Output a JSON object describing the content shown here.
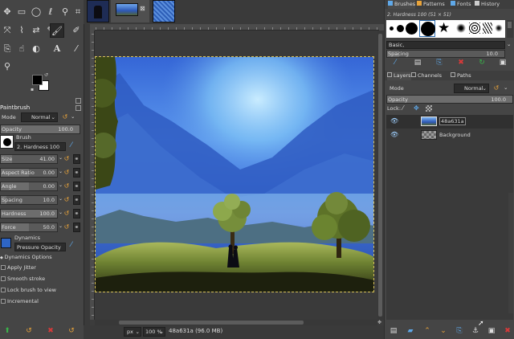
{
  "colors": {
    "accent_orange": "#e8a33a",
    "delete_red": "#d83a3a",
    "confirm_green": "#39b54a",
    "selection_blue": "#2b6cb0",
    "canvas_bg": "#3a3a3a"
  },
  "image_tabs": {
    "active_index": 1,
    "close_glyph": "⊠"
  },
  "tool_options": {
    "tool_name": "Paintbrush",
    "mode_label": "Mode",
    "mode_value": "Normal",
    "opacity_label": "Opacity",
    "opacity_value": "100.0",
    "brush_label": "Brush",
    "brush_value": "2. Hardness 100",
    "sliders": [
      {
        "label": "Size",
        "value": "41.00",
        "level": 0.2
      },
      {
        "label": "Aspect Ratio",
        "value": "0.00",
        "level": 0.5
      },
      {
        "label": "Angle",
        "value": "0.00",
        "level": 0.5
      },
      {
        "label": "Spacing",
        "value": "10.0",
        "level": 0.1
      },
      {
        "label": "Hardness",
        "value": "100.0",
        "level": 1.0
      },
      {
        "label": "Force",
        "value": "50.0",
        "level": 0.5
      }
    ],
    "dynamics_label": "Dynamics",
    "dynamics_value": "Pressure Opacity",
    "dynamics_options": "Dynamics Options",
    "checkboxes": [
      "Apply Jitter",
      "Smooth stroke",
      "Lock brush to view",
      "Incremental"
    ]
  },
  "brushes_panel": {
    "tabs": [
      "Brushes",
      "Patterns",
      "Fonts",
      "History"
    ],
    "selected_brush": "2. Hardness 100 (51 × 51)",
    "tag_value": "Basic,",
    "spacing_label": "Spacing",
    "spacing_value": "10.0"
  },
  "layers_panel": {
    "tabs": [
      "Layers",
      "Channels",
      "Paths"
    ],
    "mode_label": "Mode",
    "mode_value": "Normal",
    "opacity_label": "Opacity",
    "opacity_value": "100.0",
    "lock_label": "Lock:",
    "layers": [
      {
        "name": "48a631a",
        "selected": true
      },
      {
        "name": "Background",
        "selected": false
      }
    ]
  },
  "status_bar": {
    "unit": "px",
    "zoom": "100 %",
    "info": "48a631a (96.0 MB)"
  }
}
